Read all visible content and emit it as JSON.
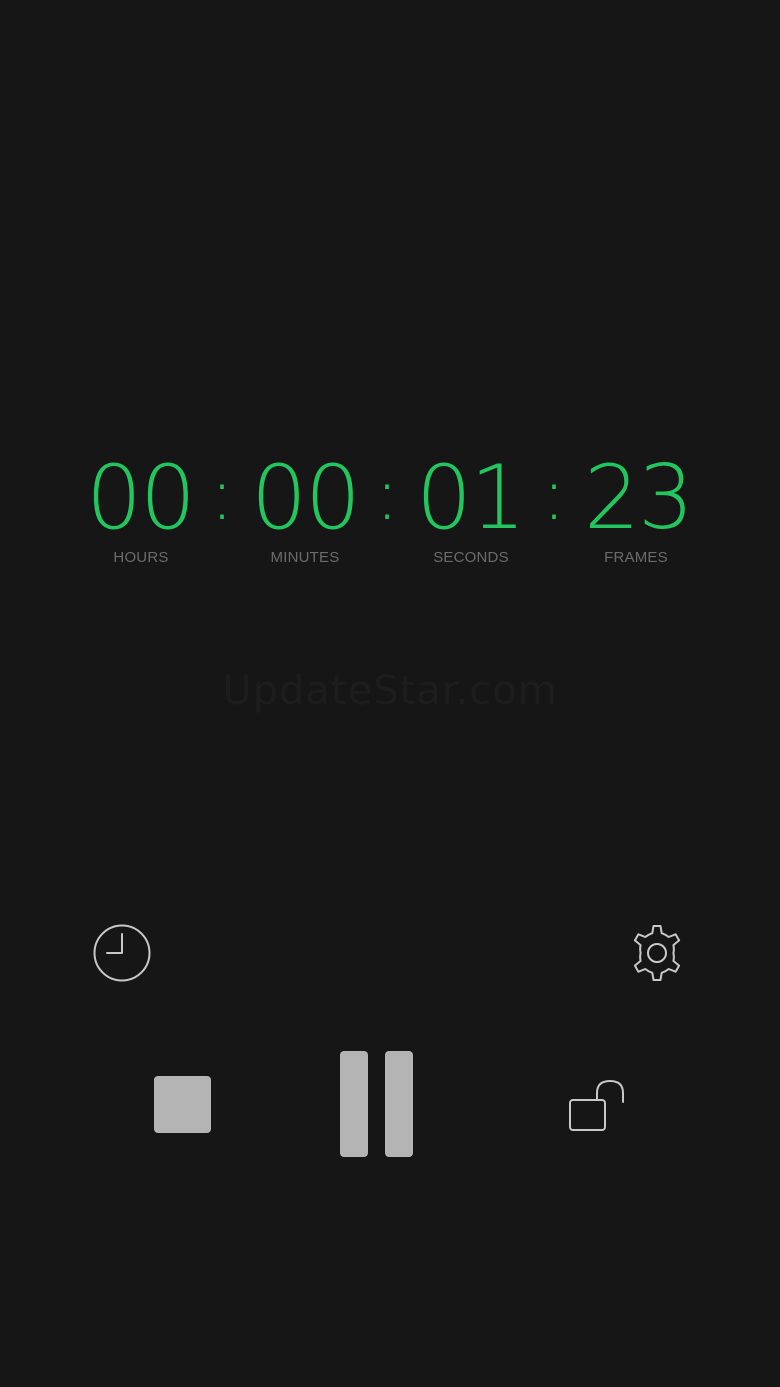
{
  "timecode": {
    "hours": "00",
    "minutes": "00",
    "seconds": "01",
    "frames": "23",
    "separator": ":"
  },
  "labels": {
    "hours": "HOURS",
    "minutes": "MINUTES",
    "seconds": "SECONDS",
    "frames": "FRAMES"
  },
  "watermark": "UpdateStar.com",
  "icons": {
    "history": "clock-icon",
    "settings": "gear-icon",
    "stop": "stop-icon",
    "pause": "pause-icon",
    "lock": "unlock-icon"
  },
  "colors": {
    "background": "#161617",
    "digits": "#22c55e",
    "label": "#6b6b6b",
    "control": "#b4b4b4",
    "icon_stroke": "#c8c8c8"
  }
}
